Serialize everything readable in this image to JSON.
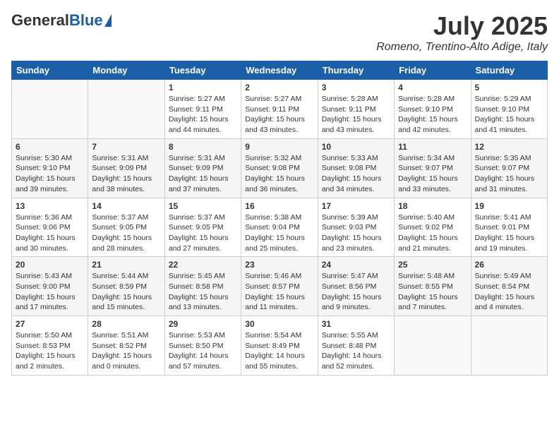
{
  "header": {
    "logo_general": "General",
    "logo_blue": "Blue",
    "month_title": "July 2025",
    "location": "Romeno, Trentino-Alto Adige, Italy"
  },
  "calendar": {
    "days_of_week": [
      "Sunday",
      "Monday",
      "Tuesday",
      "Wednesday",
      "Thursday",
      "Friday",
      "Saturday"
    ],
    "weeks": [
      [
        {
          "day": "",
          "content": ""
        },
        {
          "day": "",
          "content": ""
        },
        {
          "day": "1",
          "content": "Sunrise: 5:27 AM\nSunset: 9:11 PM\nDaylight: 15 hours\nand 44 minutes."
        },
        {
          "day": "2",
          "content": "Sunrise: 5:27 AM\nSunset: 9:11 PM\nDaylight: 15 hours\nand 43 minutes."
        },
        {
          "day": "3",
          "content": "Sunrise: 5:28 AM\nSunset: 9:11 PM\nDaylight: 15 hours\nand 43 minutes."
        },
        {
          "day": "4",
          "content": "Sunrise: 5:28 AM\nSunset: 9:10 PM\nDaylight: 15 hours\nand 42 minutes."
        },
        {
          "day": "5",
          "content": "Sunrise: 5:29 AM\nSunset: 9:10 PM\nDaylight: 15 hours\nand 41 minutes."
        }
      ],
      [
        {
          "day": "6",
          "content": "Sunrise: 5:30 AM\nSunset: 9:10 PM\nDaylight: 15 hours\nand 39 minutes."
        },
        {
          "day": "7",
          "content": "Sunrise: 5:31 AM\nSunset: 9:09 PM\nDaylight: 15 hours\nand 38 minutes."
        },
        {
          "day": "8",
          "content": "Sunrise: 5:31 AM\nSunset: 9:09 PM\nDaylight: 15 hours\nand 37 minutes."
        },
        {
          "day": "9",
          "content": "Sunrise: 5:32 AM\nSunset: 9:08 PM\nDaylight: 15 hours\nand 36 minutes."
        },
        {
          "day": "10",
          "content": "Sunrise: 5:33 AM\nSunset: 9:08 PM\nDaylight: 15 hours\nand 34 minutes."
        },
        {
          "day": "11",
          "content": "Sunrise: 5:34 AM\nSunset: 9:07 PM\nDaylight: 15 hours\nand 33 minutes."
        },
        {
          "day": "12",
          "content": "Sunrise: 5:35 AM\nSunset: 9:07 PM\nDaylight: 15 hours\nand 31 minutes."
        }
      ],
      [
        {
          "day": "13",
          "content": "Sunrise: 5:36 AM\nSunset: 9:06 PM\nDaylight: 15 hours\nand 30 minutes."
        },
        {
          "day": "14",
          "content": "Sunrise: 5:37 AM\nSunset: 9:05 PM\nDaylight: 15 hours\nand 28 minutes."
        },
        {
          "day": "15",
          "content": "Sunrise: 5:37 AM\nSunset: 9:05 PM\nDaylight: 15 hours\nand 27 minutes."
        },
        {
          "day": "16",
          "content": "Sunrise: 5:38 AM\nSunset: 9:04 PM\nDaylight: 15 hours\nand 25 minutes."
        },
        {
          "day": "17",
          "content": "Sunrise: 5:39 AM\nSunset: 9:03 PM\nDaylight: 15 hours\nand 23 minutes."
        },
        {
          "day": "18",
          "content": "Sunrise: 5:40 AM\nSunset: 9:02 PM\nDaylight: 15 hours\nand 21 minutes."
        },
        {
          "day": "19",
          "content": "Sunrise: 5:41 AM\nSunset: 9:01 PM\nDaylight: 15 hours\nand 19 minutes."
        }
      ],
      [
        {
          "day": "20",
          "content": "Sunrise: 5:43 AM\nSunset: 9:00 PM\nDaylight: 15 hours\nand 17 minutes."
        },
        {
          "day": "21",
          "content": "Sunrise: 5:44 AM\nSunset: 8:59 PM\nDaylight: 15 hours\nand 15 minutes."
        },
        {
          "day": "22",
          "content": "Sunrise: 5:45 AM\nSunset: 8:58 PM\nDaylight: 15 hours\nand 13 minutes."
        },
        {
          "day": "23",
          "content": "Sunrise: 5:46 AM\nSunset: 8:57 PM\nDaylight: 15 hours\nand 11 minutes."
        },
        {
          "day": "24",
          "content": "Sunrise: 5:47 AM\nSunset: 8:56 PM\nDaylight: 15 hours\nand 9 minutes."
        },
        {
          "day": "25",
          "content": "Sunrise: 5:48 AM\nSunset: 8:55 PM\nDaylight: 15 hours\nand 7 minutes."
        },
        {
          "day": "26",
          "content": "Sunrise: 5:49 AM\nSunset: 8:54 PM\nDaylight: 15 hours\nand 4 minutes."
        }
      ],
      [
        {
          "day": "27",
          "content": "Sunrise: 5:50 AM\nSunset: 8:53 PM\nDaylight: 15 hours\nand 2 minutes."
        },
        {
          "day": "28",
          "content": "Sunrise: 5:51 AM\nSunset: 8:52 PM\nDaylight: 15 hours\nand 0 minutes."
        },
        {
          "day": "29",
          "content": "Sunrise: 5:53 AM\nSunset: 8:50 PM\nDaylight: 14 hours\nand 57 minutes."
        },
        {
          "day": "30",
          "content": "Sunrise: 5:54 AM\nSunset: 8:49 PM\nDaylight: 14 hours\nand 55 minutes."
        },
        {
          "day": "31",
          "content": "Sunrise: 5:55 AM\nSunset: 8:48 PM\nDaylight: 14 hours\nand 52 minutes."
        },
        {
          "day": "",
          "content": ""
        },
        {
          "day": "",
          "content": ""
        }
      ]
    ]
  }
}
